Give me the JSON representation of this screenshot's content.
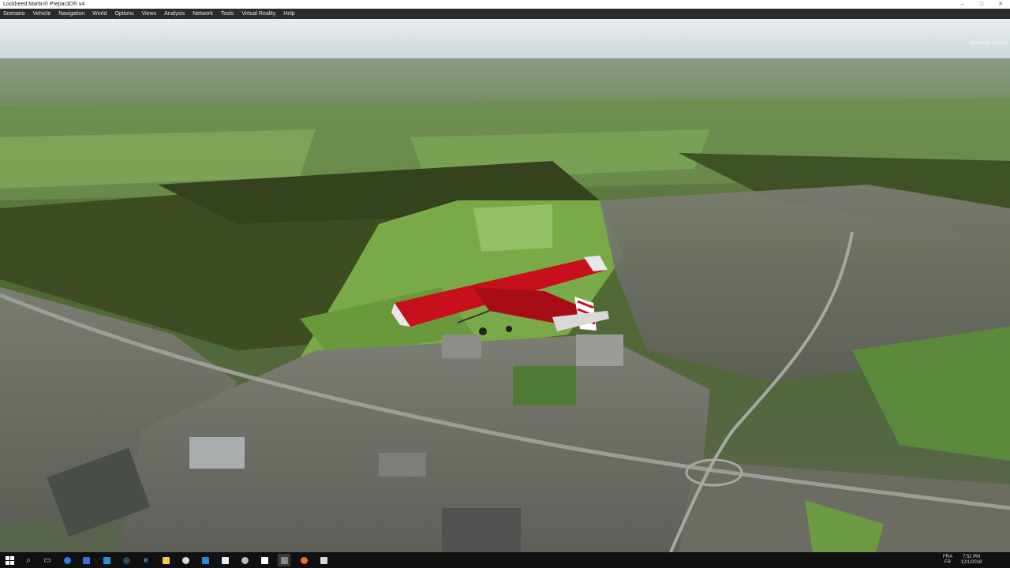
{
  "window": {
    "title": "Lockheed Martin® Prepar3D® v4",
    "controls": [
      "–",
      "□",
      "✕"
    ]
  },
  "menu": {
    "items": [
      "Scenario",
      "Vehicle",
      "Navigation",
      "World",
      "Options",
      "Views",
      "Analysis",
      "Network",
      "Tools",
      "Virtual Reality",
      "Help"
    ]
  },
  "scene": {
    "license_text": "Academic License",
    "aircraft_color": "#c8101c",
    "sky_color": "#dfe6ea",
    "forest_color": "#3b4a1f",
    "field_color": "#7fb04c"
  },
  "taskbar": {
    "icons": [
      "windows-start-icon",
      "search-icon",
      "task-view-icon",
      "cortana-icon",
      "files-app-icon",
      "store-icon",
      "steam-icon",
      "edge-icon",
      "file-explorer-icon",
      "chrome-icon",
      "app-icon",
      "mail-icon",
      "media-icon",
      "prepar3d-icon",
      "p3d-app-icon",
      "firefox-icon",
      "pin-icon"
    ],
    "lang_line1": "FRA",
    "lang_line2": "FR",
    "time": "7:52 PM",
    "date": "12/1/2018"
  }
}
